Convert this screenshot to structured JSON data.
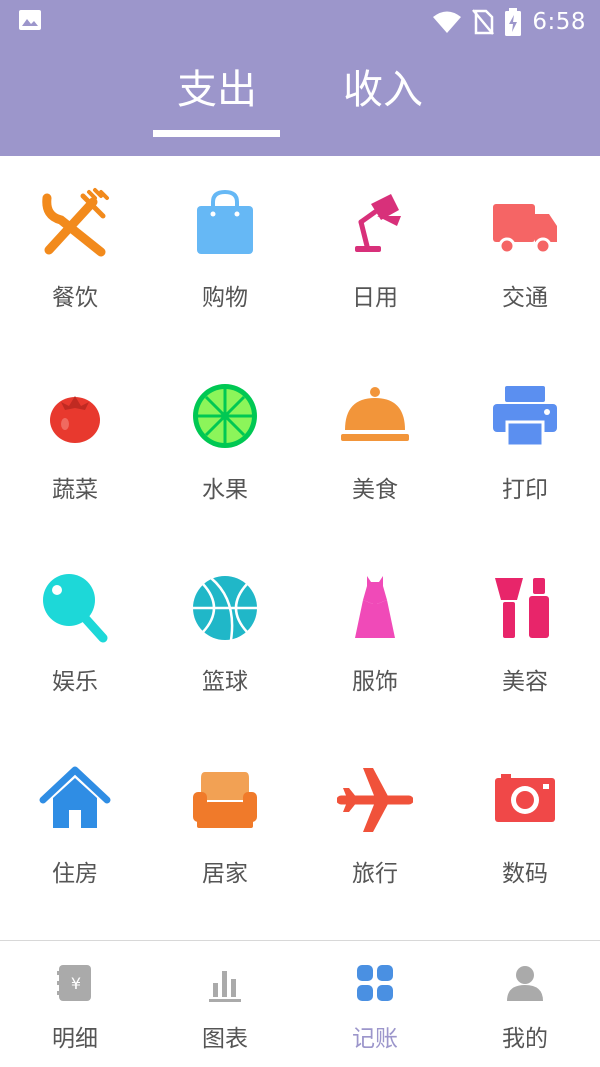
{
  "status_bar": {
    "time": "6:58"
  },
  "colors": {
    "header_bg": "#9c96cb",
    "active_nav": "#9c96cb",
    "inactive_nav_icon": "#aaaaaa",
    "active_nav_icon": "#4a90e2"
  },
  "tabs": [
    {
      "label": "支出",
      "selected": true
    },
    {
      "label": "收入",
      "selected": false
    }
  ],
  "categories": [
    {
      "label": "餐饮",
      "icon": "fork-knife-icon",
      "color": "#f28a1c"
    },
    {
      "label": "购物",
      "icon": "shopping-bag-icon",
      "color": "#66b8f5"
    },
    {
      "label": "日用",
      "icon": "desk-lamp-icon",
      "color": "#d8307a"
    },
    {
      "label": "交通",
      "icon": "truck-icon",
      "color": "#f56565"
    },
    {
      "label": "蔬菜",
      "icon": "tomato-icon",
      "color": "#e8392e"
    },
    {
      "label": "水果",
      "icon": "lime-icon",
      "color": "#3ddc4c"
    },
    {
      "label": "美食",
      "icon": "food-cloche-icon",
      "color": "#f2953a"
    },
    {
      "label": "打印",
      "icon": "printer-icon",
      "color": "#5b8ff0"
    },
    {
      "label": "娱乐",
      "icon": "ping-pong-icon",
      "color": "#1dd8d8"
    },
    {
      "label": "篮球",
      "icon": "basketball-icon",
      "color": "#20b7c8"
    },
    {
      "label": "服饰",
      "icon": "dress-icon",
      "color": "#f04ab8"
    },
    {
      "label": "美容",
      "icon": "makeup-icon",
      "color": "#e8256a"
    },
    {
      "label": "住房",
      "icon": "house-icon",
      "color": "#2f8de4"
    },
    {
      "label": "居家",
      "icon": "armchair-icon",
      "color": "#f07a2a"
    },
    {
      "label": "旅行",
      "icon": "airplane-icon",
      "color": "#f0523a"
    },
    {
      "label": "数码",
      "icon": "camera-icon",
      "color": "#f04848"
    }
  ],
  "bottom_nav": [
    {
      "label": "明细",
      "icon": "ledger-icon",
      "active": false
    },
    {
      "label": "图表",
      "icon": "bar-chart-icon",
      "active": false
    },
    {
      "label": "记账",
      "icon": "grid-icon",
      "active": true
    },
    {
      "label": "我的",
      "icon": "user-icon",
      "active": false
    }
  ]
}
